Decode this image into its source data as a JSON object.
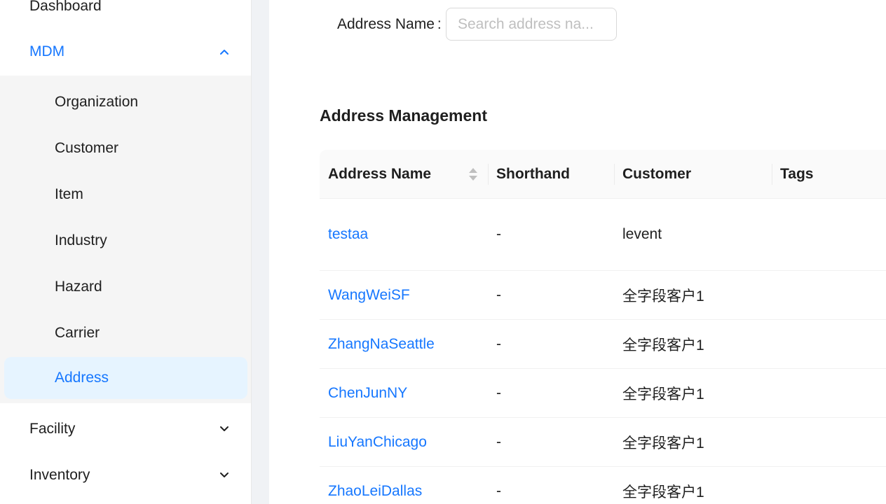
{
  "sidebar": {
    "items": [
      {
        "label": "Dashboard"
      },
      {
        "label": "MDM",
        "expanded": true
      },
      {
        "label": "Facility"
      },
      {
        "label": "Inventory"
      }
    ],
    "mdm_children": [
      {
        "label": "Organization"
      },
      {
        "label": "Customer"
      },
      {
        "label": "Item"
      },
      {
        "label": "Industry"
      },
      {
        "label": "Hazard"
      },
      {
        "label": "Carrier"
      },
      {
        "label": "Address",
        "selected": true
      }
    ]
  },
  "filter": {
    "label": "Address Name",
    "colon": ":",
    "placeholder": "Search address na...",
    "value": ""
  },
  "section_title": "Address Management",
  "table": {
    "columns": [
      "Address Name",
      "Shorthand",
      "Customer",
      "Tags"
    ],
    "rows": [
      {
        "address_name": "testaa",
        "shorthand": "-",
        "customer": "levent",
        "tags": ""
      },
      {
        "address_name": "WangWeiSF",
        "shorthand": "-",
        "customer": "全字段客户1",
        "tags": ""
      },
      {
        "address_name": "ZhangNaSeattle",
        "shorthand": "-",
        "customer": "全字段客户1",
        "tags": ""
      },
      {
        "address_name": "ChenJunNY",
        "shorthand": "-",
        "customer": "全字段客户1",
        "tags": ""
      },
      {
        "address_name": "LiuYanChicago",
        "shorthand": "-",
        "customer": "全字段客户1",
        "tags": ""
      },
      {
        "address_name": "ZhaoLeiDallas",
        "shorthand": "-",
        "customer": "全字段客户1",
        "tags": ""
      }
    ]
  },
  "colors": {
    "accent": "#1677ff",
    "selected_bg": "#e6f4ff",
    "submenu_bg": "#f5f5f5"
  },
  "icons": {
    "expand": "chevron-up-icon",
    "collapse": "chevron-down-icon",
    "sort": "sort-icon"
  }
}
